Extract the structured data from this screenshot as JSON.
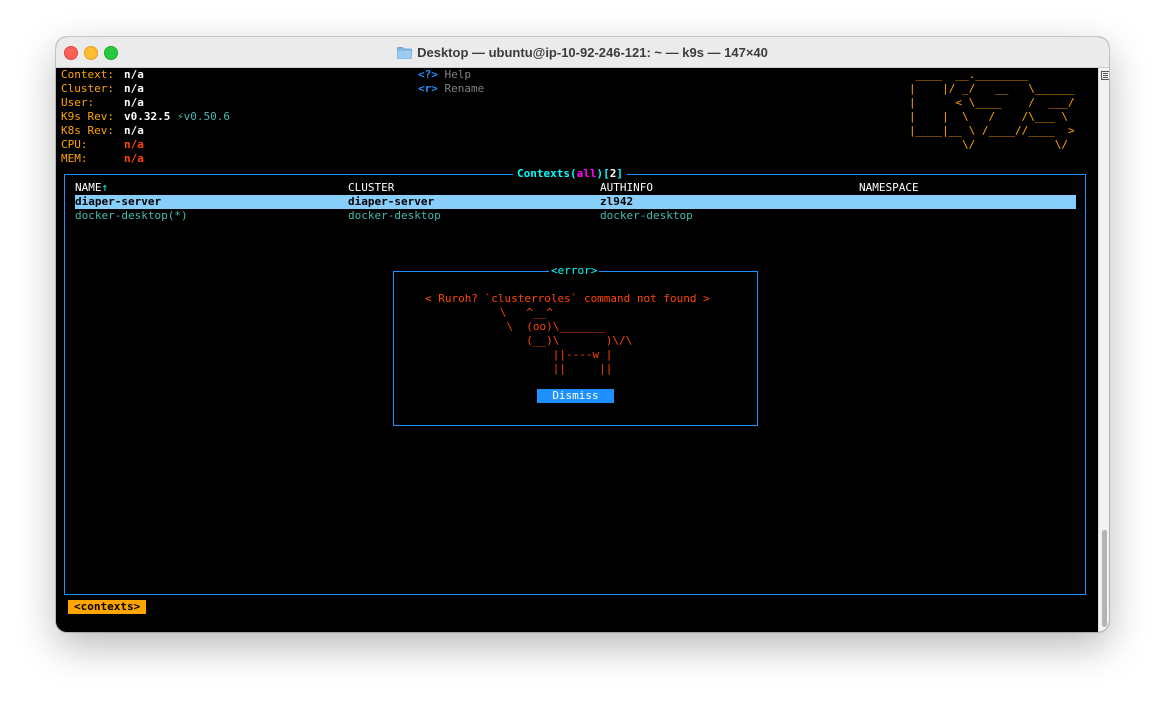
{
  "window": {
    "title": "Desktop — ubuntu@ip-10-92-246-121: ~ — k9s — 147×40",
    "folder_icon": "folder-icon"
  },
  "info": {
    "context_label": "Context:",
    "context_value": "n/a",
    "cluster_label": "Cluster:",
    "cluster_value": "n/a",
    "user_label": "User:",
    "user_value": "n/a",
    "k9s_rev_label": "K9s Rev:",
    "k9s_rev_value": "v0.32.5",
    "k9s_rev_update": "⚡v0.50.6",
    "k8s_rev_label": "K8s Rev:",
    "k8s_rev_value": "n/a",
    "cpu_label": "CPU:",
    "cpu_value": "n/a",
    "mem_label": "MEM:",
    "mem_value": "n/a"
  },
  "hints": [
    {
      "key": "<?>",
      "label": "Help"
    },
    {
      "key": "<r>",
      "label": "Rename"
    }
  ],
  "logo_lines": [
    " ____  __.________       ",
    "|    |/ _/   __   \\______",
    "|      < \\____    /  ___/",
    "|    |  \\   /    /\\___ \\ ",
    "|____|__ \\ /____//____  >",
    "        \\/            \\/ "
  ],
  "panel": {
    "title_prefix": "Contexts(",
    "title_filter": "all",
    "title_mid": ")[",
    "title_count": "2",
    "title_suffix": "]"
  },
  "table": {
    "headers": [
      "NAME",
      "CLUSTER",
      "AUTHINFO",
      "NAMESPACE"
    ],
    "sort_arrow": "↑",
    "rows": [
      [
        "diaper-server",
        "diaper-server",
        "zl942",
        ""
      ],
      [
        "docker-desktop(*)",
        "docker-desktop",
        "docker-desktop",
        ""
      ]
    ]
  },
  "dialog": {
    "title": "<error>",
    "message": "< Ruroh? `clusterroles` command not found >",
    "cow_lines": [
      "      \\   ^__^",
      "       \\  (oo)\\_______",
      "          (__)\\       )\\/\\",
      "              ||----w |",
      "              ||     ||"
    ],
    "dismiss_label": "Dismiss"
  },
  "breadcrumb": "<contexts>"
}
